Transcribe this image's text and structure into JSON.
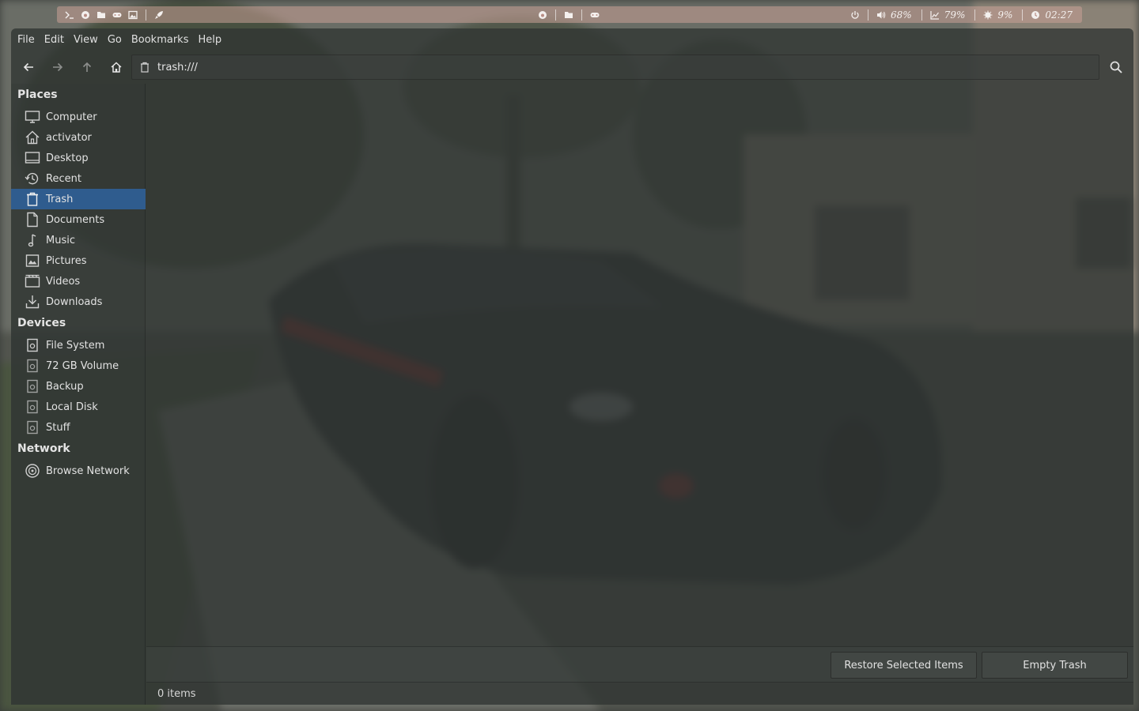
{
  "panel": {
    "left_icons": [
      "terminal-icon",
      "firefox-icon",
      "folder-icon",
      "gamepad-icon",
      "image-icon",
      "rocket-icon"
    ],
    "center_icons": [
      "firefox-icon",
      "folder-icon",
      "gamepad-icon"
    ],
    "volume": "68%",
    "cpu": "79%",
    "memory": "9%",
    "clock": "02:27"
  },
  "menubar": {
    "items": [
      "File",
      "Edit",
      "View",
      "Go",
      "Bookmarks",
      "Help"
    ]
  },
  "toolbar": {
    "location": "trash:///"
  },
  "sidebar": {
    "sections": [
      {
        "title": "Places",
        "items": [
          {
            "label": "Computer",
            "icon": "computer-icon"
          },
          {
            "label": "activator",
            "icon": "home-icon"
          },
          {
            "label": "Desktop",
            "icon": "desktop-icon"
          },
          {
            "label": "Recent",
            "icon": "recent-icon"
          },
          {
            "label": "Trash",
            "icon": "trash-icon",
            "selected": true
          },
          {
            "label": "Documents",
            "icon": "document-icon"
          },
          {
            "label": "Music",
            "icon": "music-icon"
          },
          {
            "label": "Pictures",
            "icon": "pictures-icon"
          },
          {
            "label": "Videos",
            "icon": "videos-icon"
          },
          {
            "label": "Downloads",
            "icon": "downloads-icon"
          }
        ]
      },
      {
        "title": "Devices",
        "items": [
          {
            "label": "File System",
            "icon": "drive-icon"
          },
          {
            "label": "72 GB Volume",
            "icon": "drive-icon"
          },
          {
            "label": "Backup",
            "icon": "drive-icon"
          },
          {
            "label": "Local Disk",
            "icon": "drive-icon"
          },
          {
            "label": "Stuff",
            "icon": "drive-icon"
          }
        ]
      },
      {
        "title": "Network",
        "items": [
          {
            "label": "Browse Network",
            "icon": "network-icon"
          }
        ]
      }
    ]
  },
  "trash_bar": {
    "restore_label": "Restore Selected Items",
    "empty_label": "Empty Trash"
  },
  "status": {
    "text": "0 items"
  },
  "colors": {
    "selection": "#2f5c8e",
    "panel": "#c8a096"
  }
}
